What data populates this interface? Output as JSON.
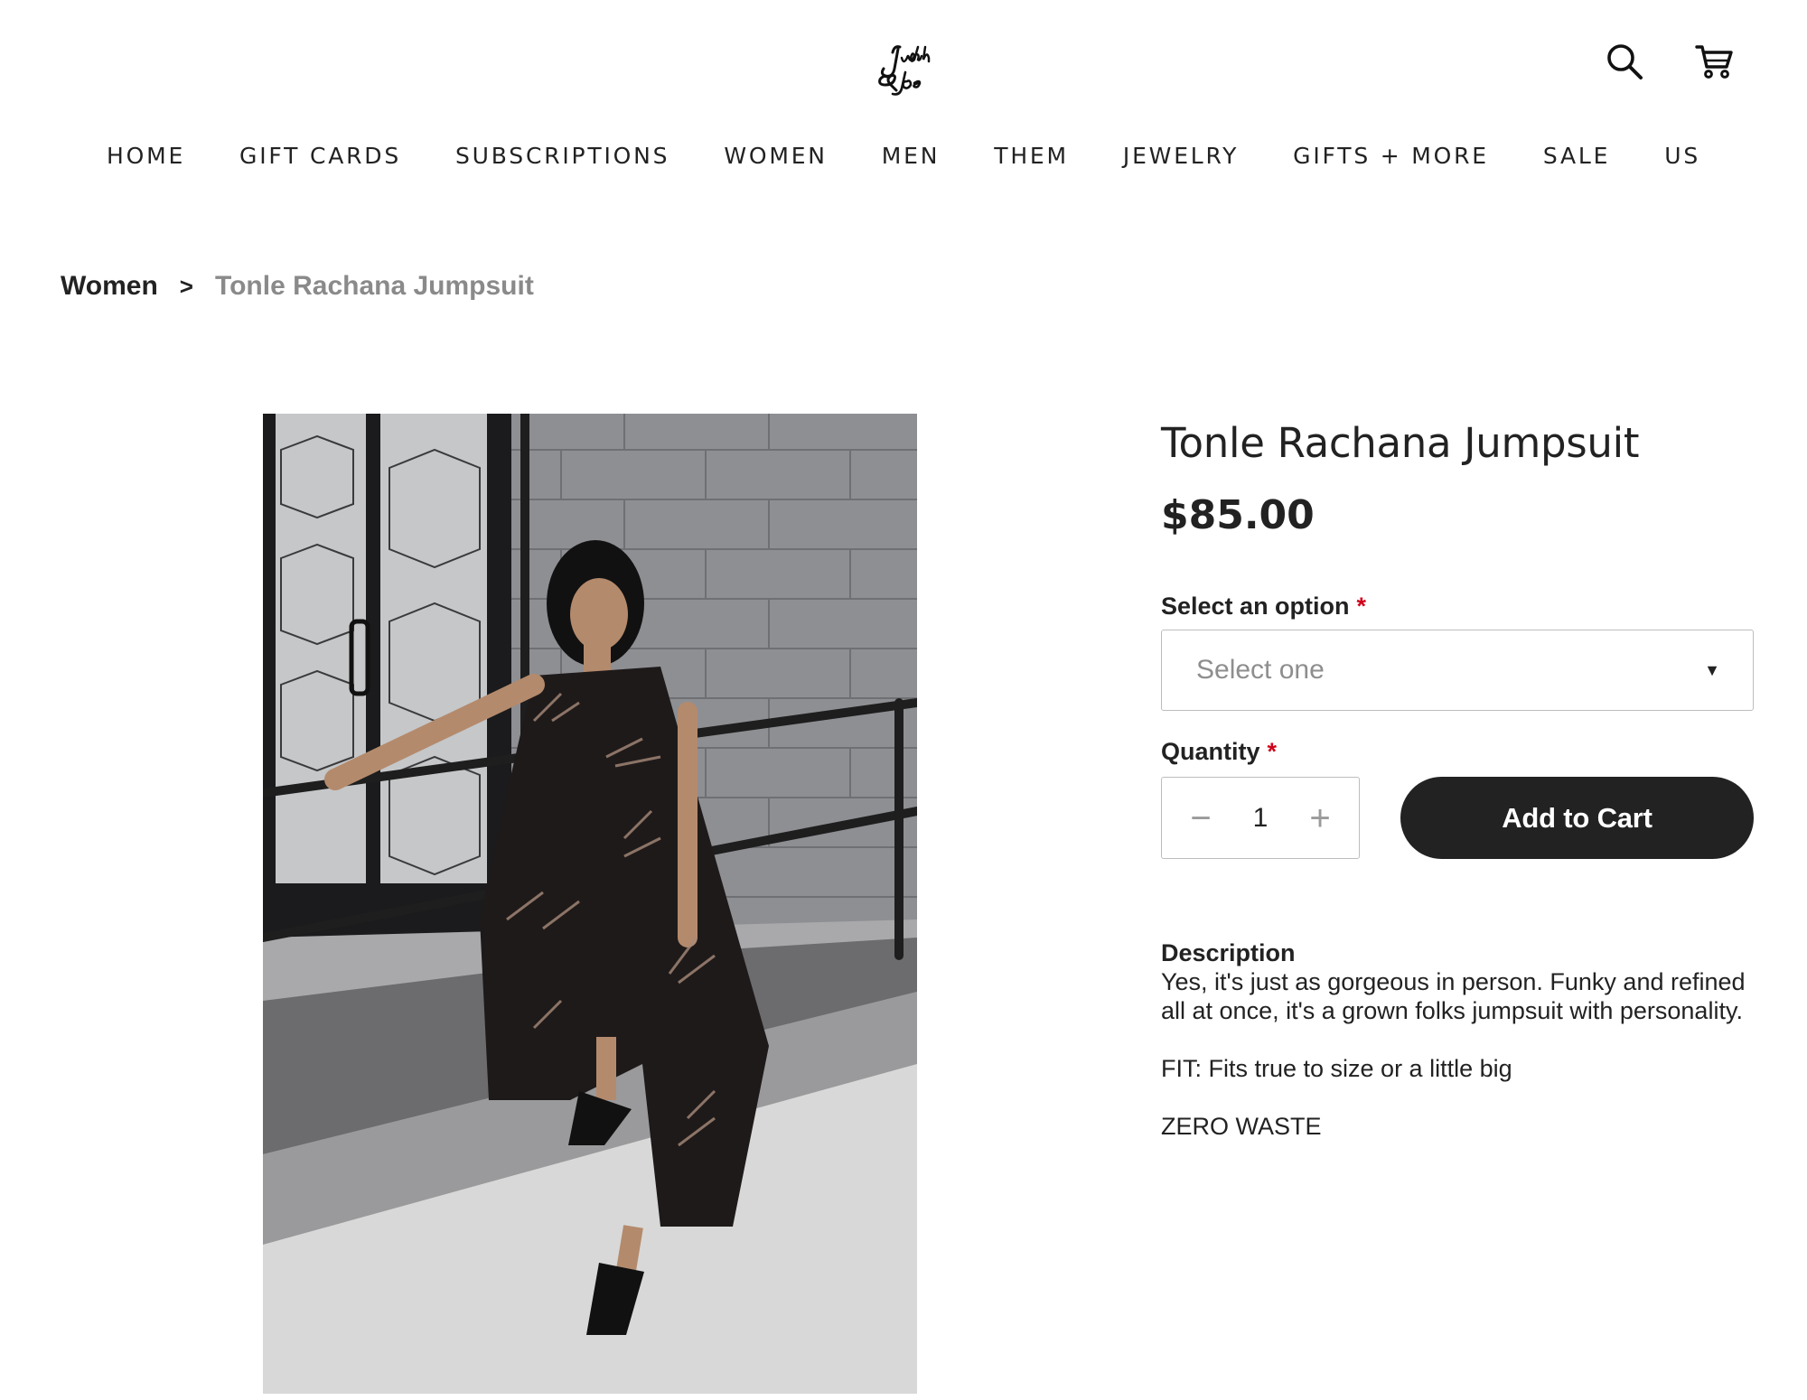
{
  "header": {
    "brand": "Judith & Joe",
    "icons": [
      "search-icon",
      "cart-icon"
    ]
  },
  "nav": {
    "items": [
      "HOME",
      "GIFT CARDS",
      "SUBSCRIPTIONS",
      "WOMEN",
      "MEN",
      "THEM",
      "JEWELRY",
      "GIFTS + MORE",
      "SALE",
      "US"
    ]
  },
  "breadcrumb": {
    "parent": "Women",
    "separator": ">",
    "current": "Tonle Rachana Jumpsuit"
  },
  "product": {
    "title": "Tonle Rachana Jumpsuit",
    "price": "$85.00",
    "option_label": "Select an option",
    "option_placeholder": "Select one",
    "quantity_label": "Quantity",
    "required_marker": "*",
    "quantity_value": "1",
    "decrement_symbol": "−",
    "increment_symbol": "+",
    "add_to_cart_label": "Add to Cart",
    "description_heading": "Description",
    "description_lines": [
      "Yes, it's just as gorgeous in person. Funky and refined all at once, it's a grown folks jumpsuit with personality.",
      "FIT: Fits true to size or a little big",
      "ZERO WASTE"
    ]
  },
  "colors": {
    "text": "#222222",
    "muted": "#8a8a8a",
    "required": "#d0021b",
    "button_bg": "#222222",
    "button_text": "#ffffff",
    "border": "#bdbdbd"
  }
}
